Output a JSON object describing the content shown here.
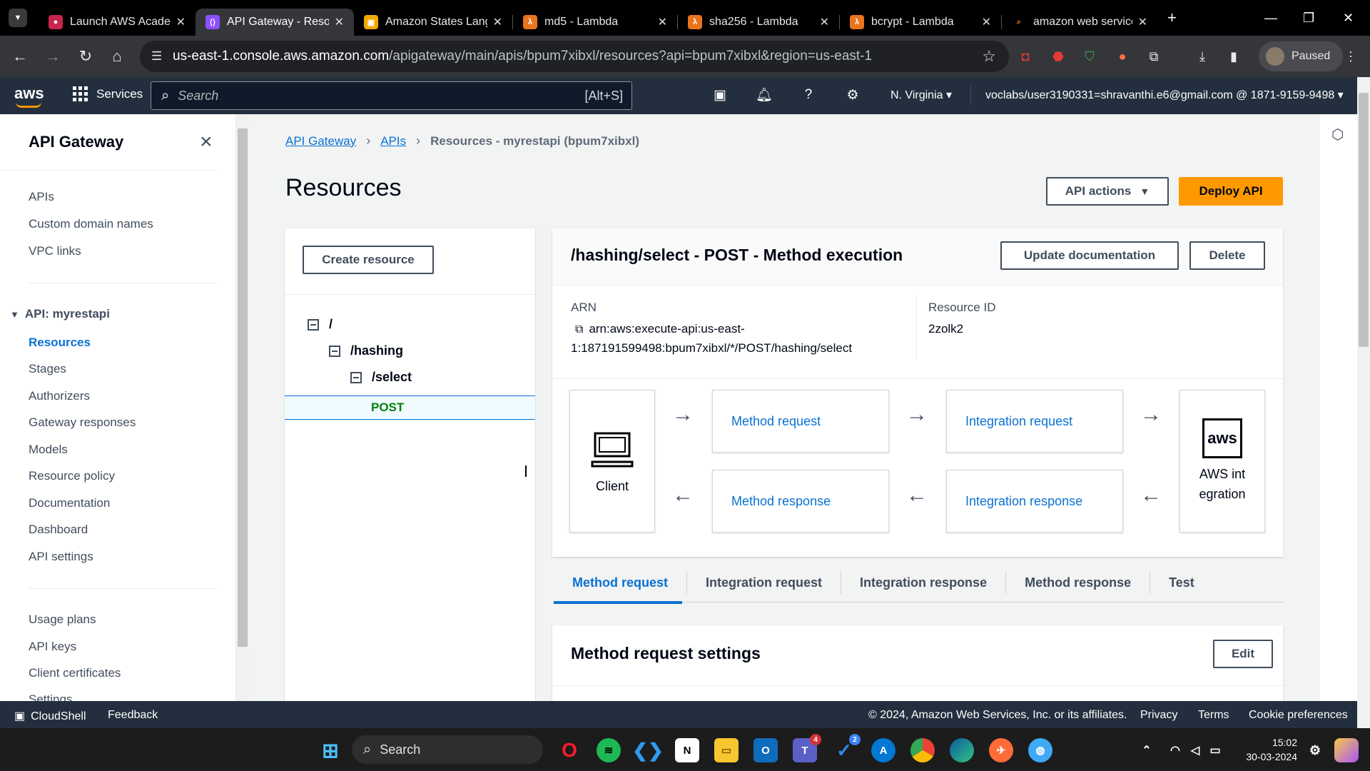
{
  "browser": {
    "tabs": [
      {
        "title": "Launch AWS Academ",
        "favicon_color": "#c7254e",
        "active": false
      },
      {
        "title": "API Gateway - Resou",
        "favicon_color": "#8c4fff",
        "active": true
      },
      {
        "title": "Amazon States Langu",
        "favicon_color": "#f2a900",
        "active": false
      },
      {
        "title": "md5 - Lambda",
        "favicon_color": "#e8741c",
        "active": false
      },
      {
        "title": "sha256 - Lambda",
        "favicon_color": "#e8741c",
        "active": false
      },
      {
        "title": "bcrypt - Lambda",
        "favicon_color": "#e8741c",
        "active": false
      },
      {
        "title": "amazon web services",
        "favicon_color": "#e8741c",
        "active": false
      }
    ],
    "url_host": "us-east-1.console.aws.amazon.com",
    "url_path": "/apigateway/main/apis/bpum7xibxl/resources?api=bpum7xibxl&region=us-east-1",
    "profile_label": "Paused"
  },
  "awsnav": {
    "logo": "aws",
    "services_label": "Services",
    "search_placeholder": "Search",
    "search_hint": "[Alt+S]",
    "region": "N. Virginia",
    "account": "voclabs/user3190331=shravanthi.e6@gmail.com @ 1871-9159-9498"
  },
  "sidebar": {
    "title": "API Gateway",
    "top_items": [
      "APIs",
      "Custom domain names",
      "VPC links"
    ],
    "api_section": "API: myrestapi",
    "api_items": [
      "Resources",
      "Stages",
      "Authorizers",
      "Gateway responses",
      "Models",
      "Resource policy",
      "Documentation",
      "Dashboard",
      "API settings"
    ],
    "bottom_items": [
      "Usage plans",
      "API keys",
      "Client certificates",
      "Settings"
    ],
    "active_item": "Resources"
  },
  "breadcrumb": {
    "items": [
      "API Gateway",
      "APIs"
    ],
    "current": "Resources - myrestapi (bpum7xibxl)"
  },
  "page": {
    "title": "Resources",
    "api_actions_label": "API actions",
    "deploy_label": "Deploy API"
  },
  "tree": {
    "create_label": "Create resource",
    "nodes": [
      "/",
      "/hashing",
      "/select"
    ],
    "method": "POST"
  },
  "method_execution": {
    "title": "/hashing/select - POST - Method execution",
    "update_doc_label": "Update documentation",
    "delete_label": "Delete",
    "arn_label": "ARN",
    "arn_line1": "arn:aws:execute-api:us-east-",
    "arn_line2": "1:187191599498:bpum7xibxl/*/POST/hashing/select",
    "resource_id_label": "Resource ID",
    "resource_id": "2zolk2",
    "client_label": "Client",
    "method_request": "Method request",
    "integration_request": "Integration request",
    "method_response": "Method response",
    "integration_response": "Integration response",
    "aws_logo": "aws",
    "aws_integration_label": "AWS integration"
  },
  "tabs": {
    "items": [
      "Method request",
      "Integration request",
      "Integration response",
      "Method response",
      "Test"
    ],
    "active": "Method request"
  },
  "settings": {
    "title": "Method request settings",
    "edit_label": "Edit"
  },
  "footer": {
    "cloudshell": "CloudShell",
    "feedback": "Feedback",
    "copyright": "© 2024, Amazon Web Services, Inc. or its affiliates.",
    "privacy": "Privacy",
    "terms": "Terms",
    "cookies": "Cookie preferences"
  },
  "taskbar": {
    "search_label": "Search",
    "time": "15:02",
    "date": "30-03-2024",
    "teams_badge": "4",
    "todo_badge": "2"
  }
}
